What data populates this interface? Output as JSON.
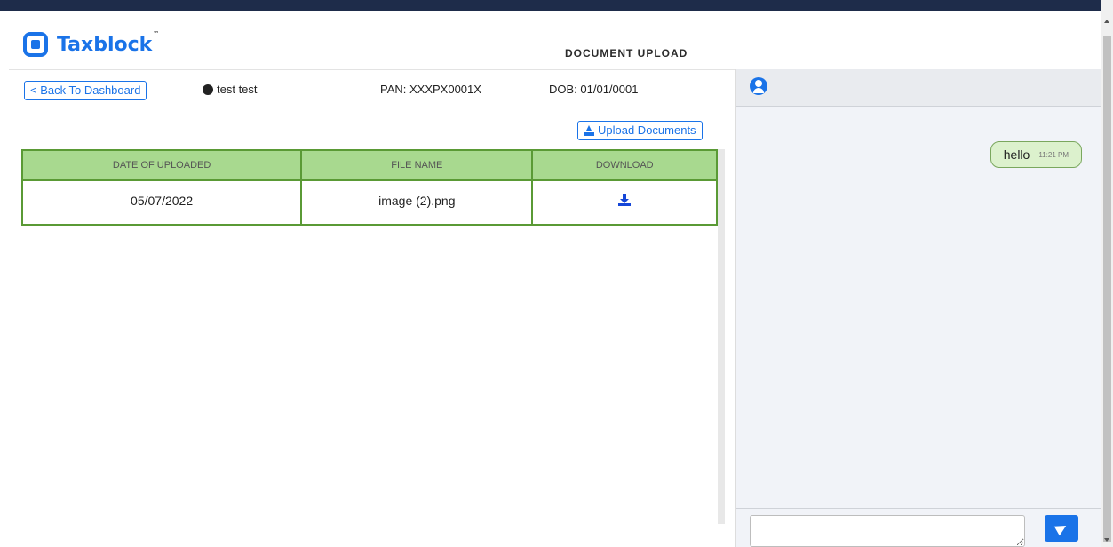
{
  "app": {
    "brand": "Taxblock",
    "trademark": "™",
    "page_title": "DOCUMENT UPLOAD"
  },
  "infobar": {
    "back_label": "< Back To Dashboard",
    "user_name": "test test",
    "pan": "PAN: XXXPX0001X",
    "dob": "DOB: 01/01/0001"
  },
  "upload": {
    "label": "Upload Documents"
  },
  "table": {
    "headers": [
      "DATE OF UPLOADED",
      "FILE NAME",
      "DOWNLOAD"
    ],
    "rows": [
      {
        "date": "05/07/2022",
        "file_name": "image (2).png"
      }
    ]
  },
  "chat": {
    "messages": [
      {
        "text": "hello",
        "time": "11:21 PM"
      }
    ],
    "input_value": ""
  },
  "colors": {
    "accent": "#1a73e8",
    "table_header": "#a8d98f",
    "table_border": "#5a9a35",
    "message_bubble": "#dcf1cd"
  }
}
